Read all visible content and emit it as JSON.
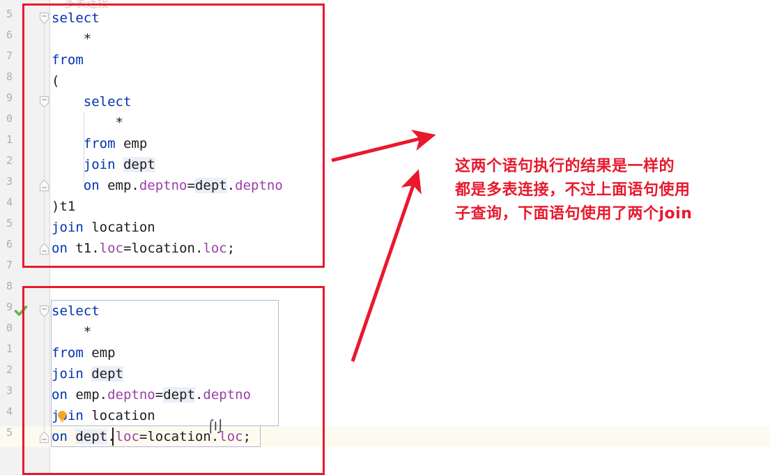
{
  "app": {
    "kind": "sql-code-editor",
    "ghost_caption": "多表连接"
  },
  "colors": {
    "annotation_red": "#e8192c",
    "keyword_blue": "#0033b3",
    "column_purple": "#9b3fa8",
    "identifier_highlight": "#eceef8",
    "gutter_bg": "#f2f2f2",
    "editor_bg": "#ffffff",
    "current_line_bg": "#fdfbf0",
    "selection_border": "#b4b8d8",
    "success_green": "#67b54a",
    "bulb_orange": "#f5a623"
  },
  "gutter": {
    "line_numbers": [
      "5",
      "6",
      "7",
      "8",
      "9",
      "0",
      "1",
      "2",
      "3",
      "4",
      "5",
      "6",
      "7",
      "8",
      "9",
      "0",
      "1",
      "2",
      "3",
      "4",
      "5"
    ],
    "success_tick_icon": "green-check-icon"
  },
  "editor": {
    "block_one": {
      "lines": [
        [
          {
            "t": "select",
            "c": "kw"
          }
        ],
        [
          {
            "t": "    *",
            "c": "plain"
          }
        ],
        [
          {
            "t": "from",
            "c": "kw"
          }
        ],
        [
          {
            "t": "(",
            "c": "plain"
          }
        ],
        [
          {
            "t": "    select",
            "c": "kw"
          }
        ],
        [
          {
            "t": "        *",
            "c": "plain"
          }
        ],
        [
          {
            "t": "    ",
            "c": "plain"
          },
          {
            "t": "from",
            "c": "kw"
          },
          {
            "t": " emp",
            "c": "plain"
          }
        ],
        [
          {
            "t": "    ",
            "c": "plain"
          },
          {
            "t": "join",
            "c": "kw"
          },
          {
            "t": " ",
            "c": "plain"
          },
          {
            "t": "dept",
            "c": "tbl"
          }
        ],
        [
          {
            "t": "    ",
            "c": "plain"
          },
          {
            "t": "on",
            "c": "kw"
          },
          {
            "t": " emp.",
            "c": "plain"
          },
          {
            "t": "deptno",
            "c": "col"
          },
          {
            "t": "=",
            "c": "op"
          },
          {
            "t": "dept",
            "c": "tbl"
          },
          {
            "t": ".",
            "c": "plain"
          },
          {
            "t": "deptno",
            "c": "col"
          }
        ],
        [
          {
            "t": ")t1",
            "c": "plain"
          }
        ],
        [
          {
            "t": "join",
            "c": "kw"
          },
          {
            "t": " location",
            "c": "plain"
          }
        ],
        [
          {
            "t": "on",
            "c": "kw"
          },
          {
            "t": " t1.",
            "c": "plain"
          },
          {
            "t": "loc",
            "c": "col"
          },
          {
            "t": "=",
            "c": "op"
          },
          {
            "t": "location.",
            "c": "plain"
          },
          {
            "t": "loc",
            "c": "col"
          },
          {
            "t": ";",
            "c": "plain"
          }
        ]
      ]
    },
    "block_two": {
      "lines": [
        [
          {
            "t": "select",
            "c": "kw"
          }
        ],
        [
          {
            "t": "    *",
            "c": "plain"
          }
        ],
        [
          {
            "t": "from",
            "c": "kw"
          },
          {
            "t": " emp",
            "c": "plain"
          }
        ],
        [
          {
            "t": "join",
            "c": "kw"
          },
          {
            "t": " ",
            "c": "plain"
          },
          {
            "t": "dept",
            "c": "tbl"
          }
        ],
        [
          {
            "t": "on",
            "c": "kw"
          },
          {
            "t": " emp.",
            "c": "plain"
          },
          {
            "t": "deptno",
            "c": "col"
          },
          {
            "t": "=",
            "c": "op"
          },
          {
            "t": "dept",
            "c": "tbl"
          },
          {
            "t": ".",
            "c": "plain"
          },
          {
            "t": "deptno",
            "c": "col"
          }
        ],
        [
          {
            "t": "join",
            "c": "kw"
          },
          {
            "t": " location",
            "c": "plain"
          }
        ],
        [
          {
            "t": "on",
            "c": "kw"
          },
          {
            "t": " ",
            "c": "plain"
          },
          {
            "t": "dept",
            "c": "tbl"
          },
          {
            "t": ".",
            "c": "plain"
          },
          {
            "t": "loc",
            "c": "col"
          },
          {
            "t": "=",
            "c": "op"
          },
          {
            "t": "location.",
            "c": "plain"
          },
          {
            "t": "loc",
            "c": "col"
          },
          {
            "t": ";",
            "c": "plain"
          }
        ]
      ],
      "intention_bulb_icon": "lightbulb-icon",
      "caret_after": "dept",
      "mouse_cursor_icon": "text-ibeam-cursor"
    }
  },
  "annotation": {
    "note_lines": [
      "这两个语句执行的结果是一样的",
      "都是多表连接，不过上面语句使用",
      "子查询，下面语句使用了两个join"
    ],
    "boxes": [
      {
        "name": "subquery-statement-box"
      },
      {
        "name": "double-join-statement-box"
      }
    ],
    "arrows": [
      {
        "name": "arrow-to-note-from-block-one"
      },
      {
        "name": "arrow-to-note-from-block-two"
      }
    ]
  }
}
